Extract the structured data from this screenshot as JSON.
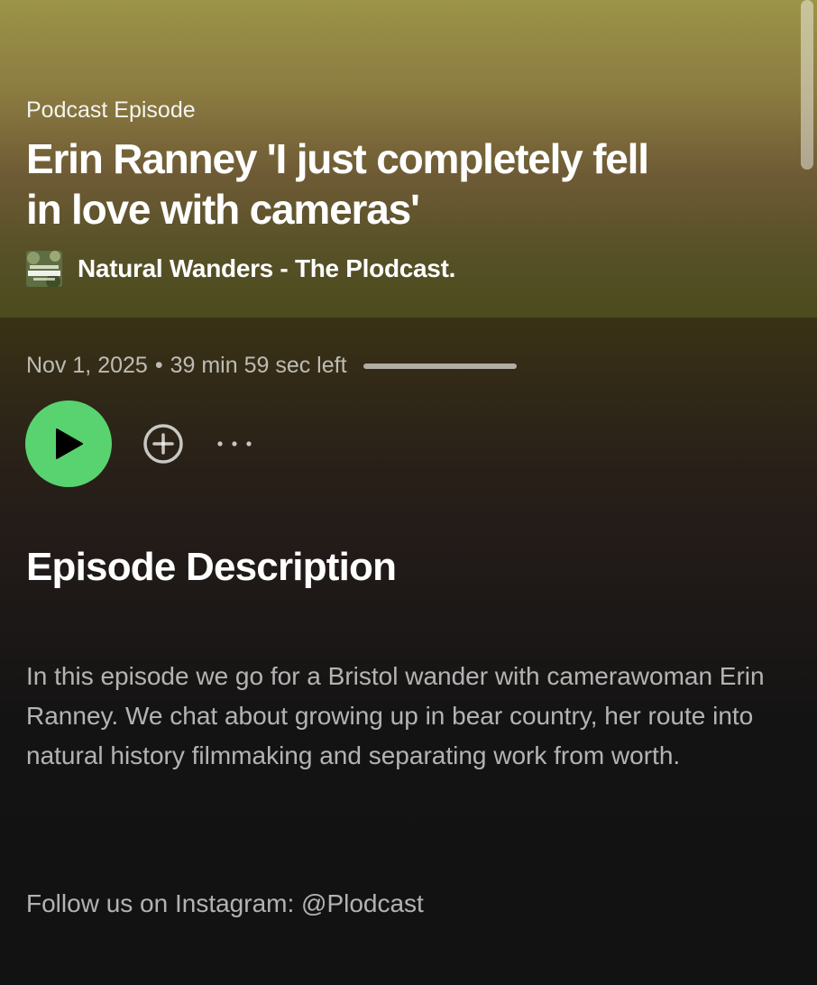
{
  "header": {
    "episode_type": "Podcast Episode",
    "title": "Erin Ranney 'I just completely fell in love with cameras'",
    "show": {
      "name": "Natural Wanders - The Plodcast.",
      "artwork_icon": "show-artwork-icon"
    }
  },
  "meta": {
    "date": "Nov 1, 2025",
    "separator": "•",
    "time_left": "39 min 59 sec left",
    "progress_fraction": 0.0
  },
  "controls": {
    "play_icon": "play-icon",
    "add_icon": "add-circle-icon",
    "more_icon": "more-dots-icon"
  },
  "description": {
    "heading": "Episode Description",
    "body": "In this episode we go for a Bristol wander with camerawoman Erin Ranney.  We chat about growing up in bear country, her route into natural history filmmaking and separating work from worth.",
    "follow": "Follow us on Instagram: @Plodcast"
  },
  "colors": {
    "accent_green": "#58d370",
    "hero_top": "#9c9448",
    "background": "#121212"
  }
}
